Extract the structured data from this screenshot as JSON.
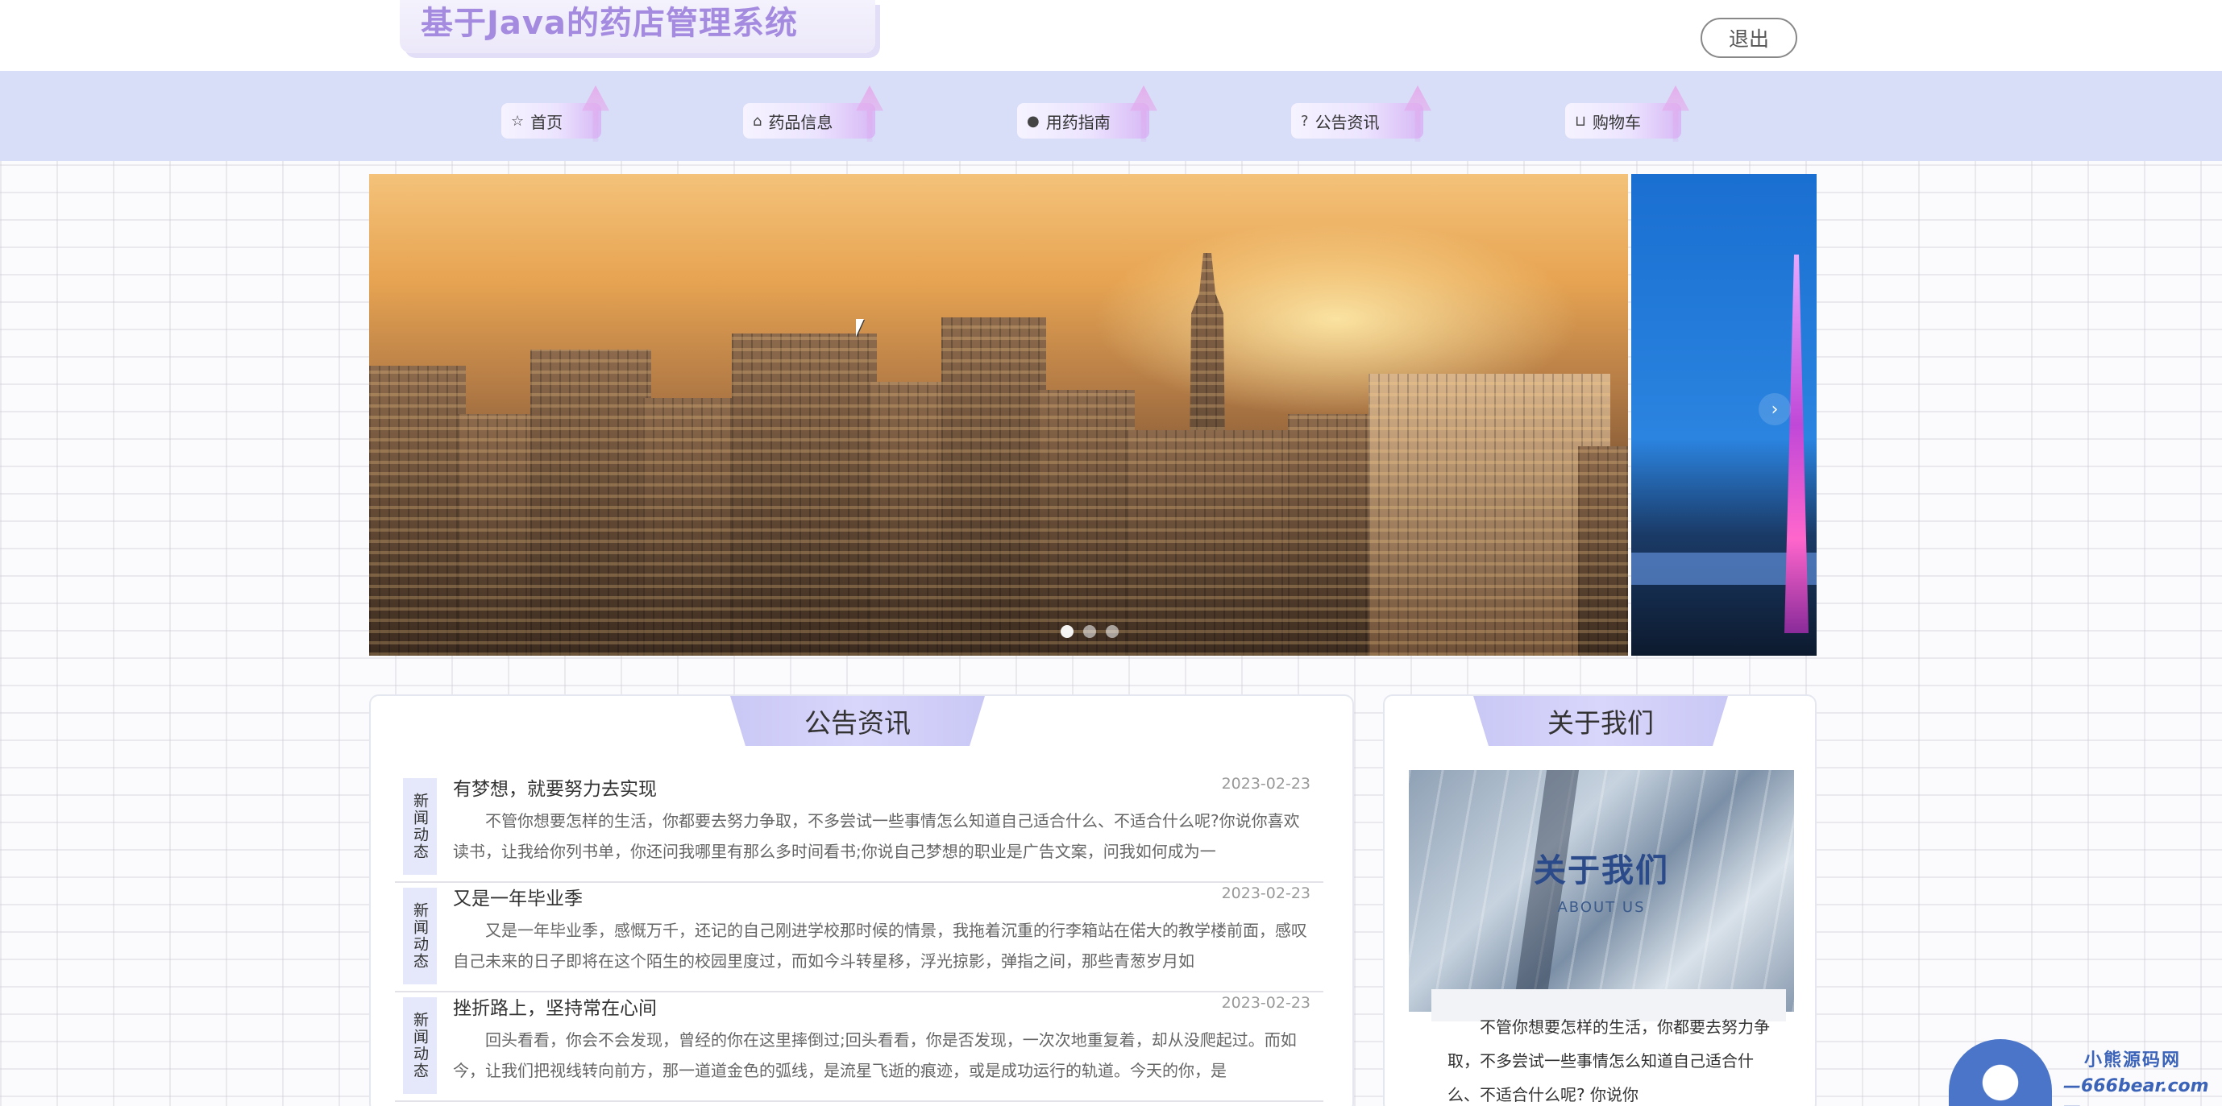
{
  "header": {
    "site_title": "基于Java的药店管理系统",
    "logout_label": "退出"
  },
  "nav": {
    "items": [
      {
        "label": "首页",
        "icon": "star-icon"
      },
      {
        "label": "药品信息",
        "icon": "bag-icon"
      },
      {
        "label": "用药指南",
        "icon": "info-icon"
      },
      {
        "label": "公告资讯",
        "icon": "question-icon"
      },
      {
        "label": "购物车",
        "icon": "cart-icon"
      }
    ]
  },
  "carousel": {
    "slides_total": 3,
    "active_index": 0
  },
  "news": {
    "section_title": "公告资讯",
    "items": [
      {
        "tag": "新闻动态",
        "title": "有梦想，就要努力去实现",
        "date": "2023-02-23",
        "summary": "不管你想要怎样的生活，你都要去努力争取，不多尝试一些事情怎么知道自己适合什么、不适合什么呢?你说你喜欢读书，让我给你列书单，你还问我哪里有那么多时间看书;你说自己梦想的职业是广告文案，问我如何成为一"
      },
      {
        "tag": "新闻动态",
        "title": "又是一年毕业季",
        "date": "2023-02-23",
        "summary": "又是一年毕业季，感慨万千，还记的自己刚进学校那时候的情景，我拖着沉重的行李箱站在偌大的教学楼前面，感叹自己未来的日子即将在这个陌生的校园里度过，而如今斗转星移，浮光掠影，弹指之间，那些青葱岁月如"
      },
      {
        "tag": "新闻动态",
        "title": "挫折路上，坚持常在心间",
        "date": "2023-02-23",
        "summary": "回头看看，你会不会发现，曾经的你在这里摔倒过;回头看看，你是否发现，一次次地重复着，却从没爬起过。而如今，让我们把视线转向前方，那一道道金色的弧线，是流星飞逝的痕迹，或是成功运行的轨道。今天的你，是"
      }
    ]
  },
  "about": {
    "section_title": "关于我们",
    "image_title": "关于我们",
    "image_subtitle": "ABOUT US",
    "text": "不管你想要怎样的生活，你都要去努力争取，不多尝试一些事情怎么知道自己适合什么、不适合什么呢? 你说你"
  },
  "watermark": {
    "line1": "小熊源码网",
    "line2": "—666bear.com—"
  }
}
